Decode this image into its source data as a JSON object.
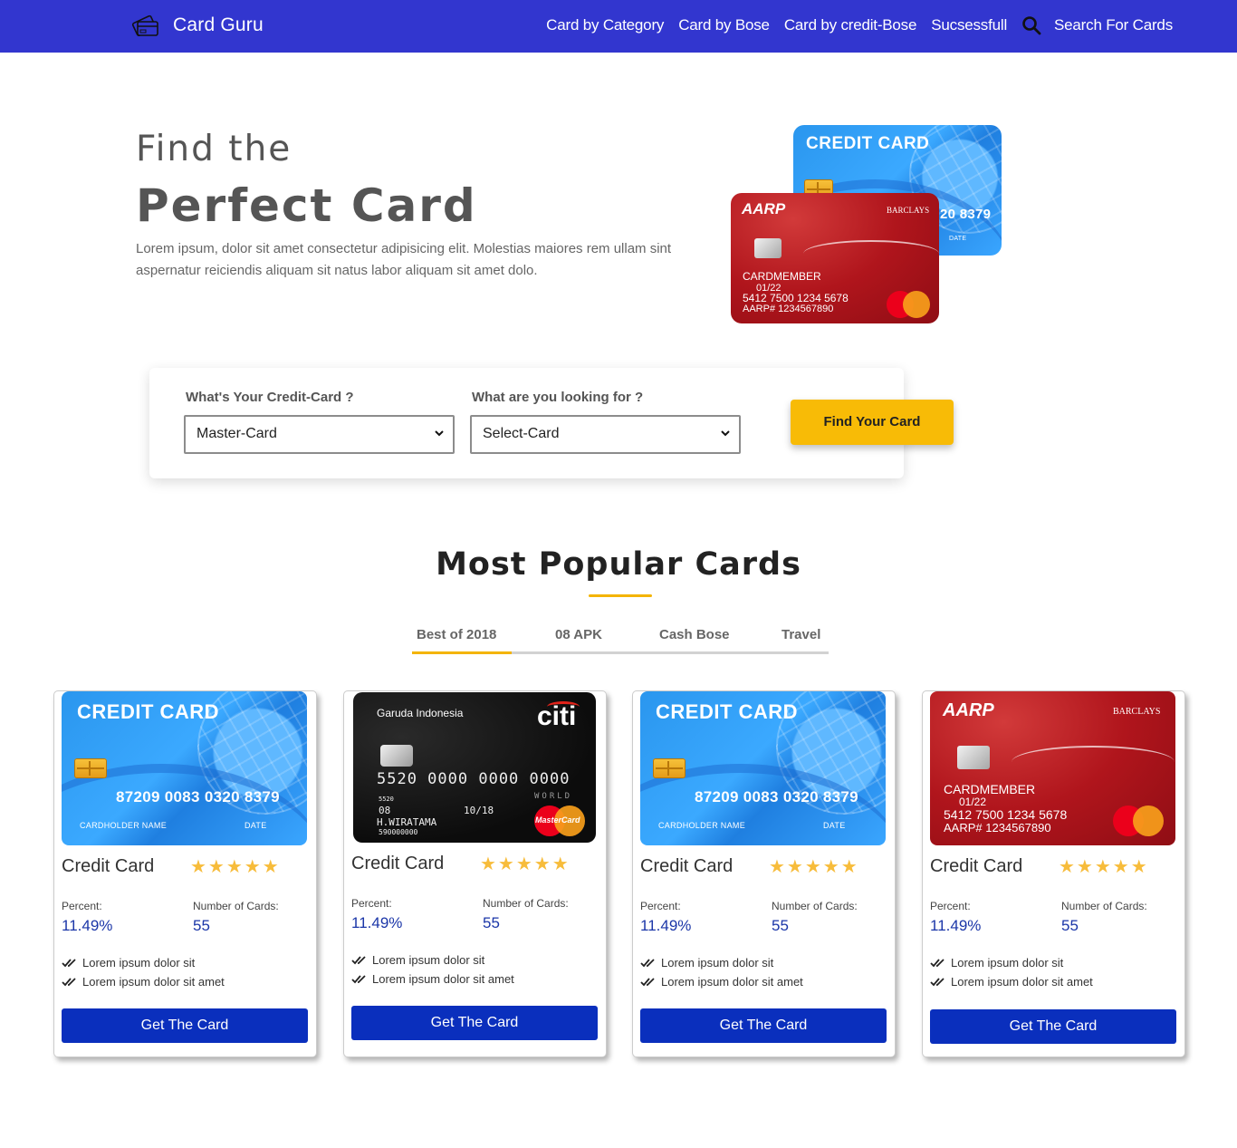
{
  "navbar": {
    "brand": "Card Guru",
    "links": [
      "Card by Category",
      "Card by Bose",
      "Card by credit-Bose",
      "Sucsessfull",
      "Search For Cards"
    ]
  },
  "hero": {
    "line1": "Find the",
    "line2": "Perfect Card",
    "description": "Lorem ipsum, dolor sit amet consectetur adipisicing elit. Molestias maiores rem ullam sint aspernatur reiciendis aliquam sit natus labor aliquam sit amet dolo."
  },
  "card_art": {
    "blue": {
      "title": "CREDIT CARD",
      "number": "87209 0083 0320 8379",
      "number_partial": "20 8379",
      "holder_label": "CARDHOLDER NAME",
      "date_label": "DATE"
    },
    "red": {
      "brand": "AARP",
      "bank": "BARCLAYS",
      "member": "CARDMEMBER",
      "expiry": "01/22",
      "number": "5412 7500 1234 5678",
      "aarp_no": "AARP# 1234567890"
    },
    "black": {
      "airline": "Garuda Indonesia",
      "bank": "citi",
      "number": "5520  0000  0000  0000",
      "small_num": "5520",
      "member_since": "08",
      "valid_thru": "10/18",
      "tier": "WORLD",
      "holder": "H.WIRATAMA",
      "gff": "590000000",
      "network": "MasterCard"
    }
  },
  "search": {
    "label1": "What's Your Credit-Card ?",
    "value1": "Master-Card",
    "label2": "What are you looking for ?",
    "value2": "Select-Card",
    "button": "Find Your Card"
  },
  "popular": {
    "title": "Most Popular Cards",
    "tabs": [
      "Best of 2018",
      "08 APK",
      "Cash Bose",
      "Travel"
    ],
    "active_tab": "Best of 2018",
    "cards": [
      {
        "name": "Credit Card",
        "stars": "★★★★★",
        "rating": 5,
        "percent_label": "Percent:",
        "percent": "11.49%",
        "count_label": "Number of Cards:",
        "count": "55",
        "features": [
          "Lorem ipsum dolor sit",
          "Lorem ipsum dolor sit amet"
        ],
        "button": "Get The Card"
      },
      {
        "name": "Credit Card",
        "stars": "★★★★★",
        "rating": 5,
        "percent_label": "Percent:",
        "percent": "11.49%",
        "count_label": "Number of Cards:",
        "count": "55",
        "features": [
          "Lorem ipsum dolor sit",
          "Lorem ipsum dolor sit amet"
        ],
        "button": "Get The Card"
      },
      {
        "name": "Credit Card",
        "stars": "★★★★★",
        "rating": 5,
        "percent_label": "Percent:",
        "percent": "11.49%",
        "count_label": "Number of Cards:",
        "count": "55",
        "features": [
          "Lorem ipsum dolor sit",
          "Lorem ipsum dolor sit amet"
        ],
        "button": "Get The Card"
      },
      {
        "name": "Credit Card",
        "stars": "★★★★★",
        "rating": 5,
        "percent_label": "Percent:",
        "percent": "11.49%",
        "count_label": "Number of Cards:",
        "count": "55",
        "features": [
          "Lorem ipsum dolor sit",
          "Lorem ipsum dolor sit amet"
        ],
        "button": "Get The Card"
      }
    ]
  },
  "colors": {
    "navbar": "#3236cf",
    "accent": "#f8bb06",
    "button": "#0a2fbd",
    "star": "#f7bc3b"
  }
}
